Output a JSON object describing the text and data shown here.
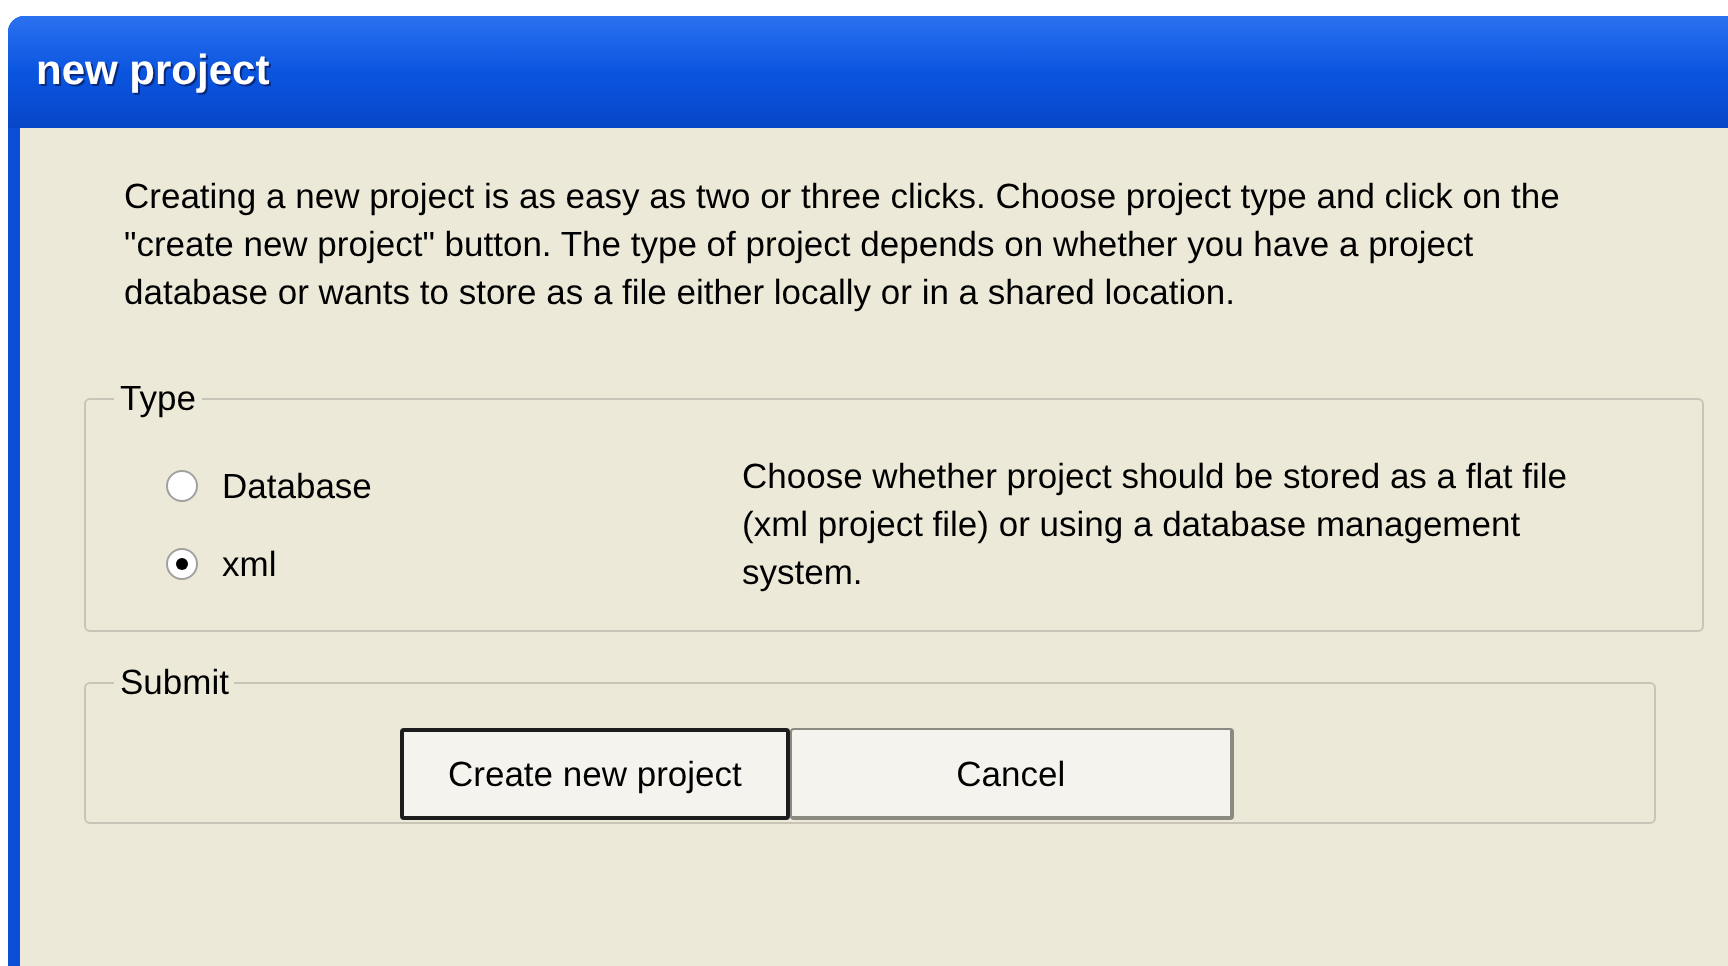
{
  "window": {
    "title": "new project"
  },
  "intro": "Creating a new project is as easy as two or three clicks. Choose project type and click on the \"create new project\" button. The type of project depends on whether you have a project database or wants to store as a file either locally or in a shared location.",
  "type_group": {
    "legend": "Type",
    "options": [
      {
        "label": "Database",
        "selected": false
      },
      {
        "label": "xml",
        "selected": true
      }
    ],
    "description": "Choose whether project should be stored as a flat file (xml project file) or using a database management system."
  },
  "submit_group": {
    "legend": "Submit",
    "buttons": [
      {
        "label": "Create new project",
        "default": true
      },
      {
        "label": "Cancel",
        "default": false
      }
    ]
  }
}
